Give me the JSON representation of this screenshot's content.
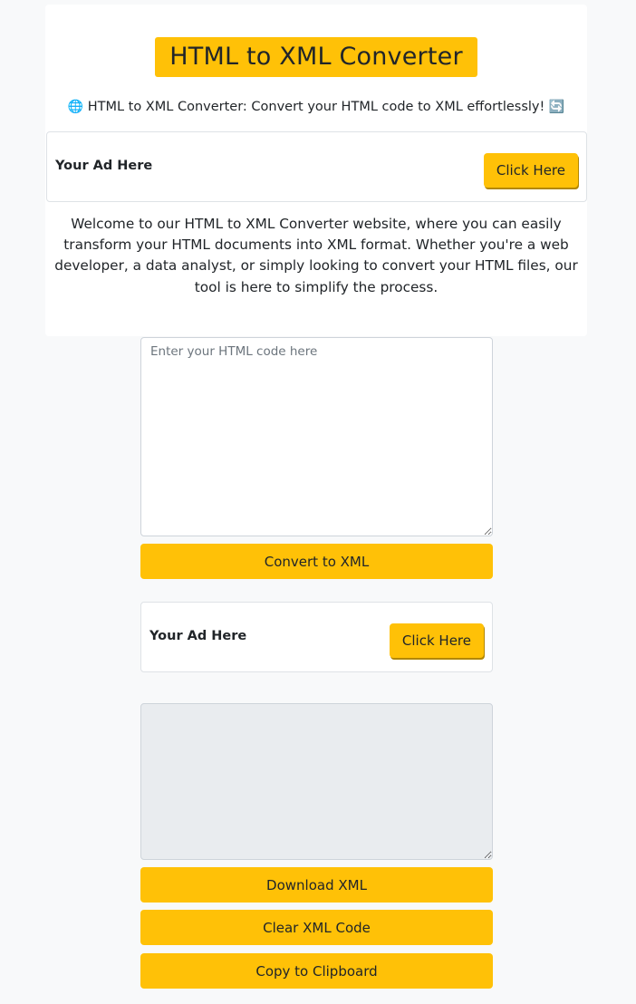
{
  "header": {
    "title": "HTML to XML Converter",
    "subtitle_icon_left": "🌐",
    "subtitle_text": "HTML to XML Converter: Convert your HTML code to XML effortlessly!",
    "subtitle_icon_right": "🔄"
  },
  "ad_top": {
    "label": "Your Ad Here",
    "button": "Click Here"
  },
  "intro": "Welcome to our HTML to XML Converter website, where you can easily transform your HTML documents into XML format. Whether you're a web developer, a data analyst, or simply looking to convert your HTML files, our tool is here to simplify the process.",
  "input": {
    "placeholder": "Enter your HTML code here",
    "value": ""
  },
  "convert_button": "Convert to XML",
  "ad_middle": {
    "label": "Your Ad Here",
    "button": "Click Here"
  },
  "output": {
    "value": ""
  },
  "actions": {
    "download": "Download XML",
    "clear": "Clear XML Code",
    "copy": "Copy to Clipboard"
  },
  "colors": {
    "accent": "#ffc107",
    "page_bg": "#f8f9fa",
    "output_bg": "#e9ecef",
    "border": "#dee2e6"
  }
}
